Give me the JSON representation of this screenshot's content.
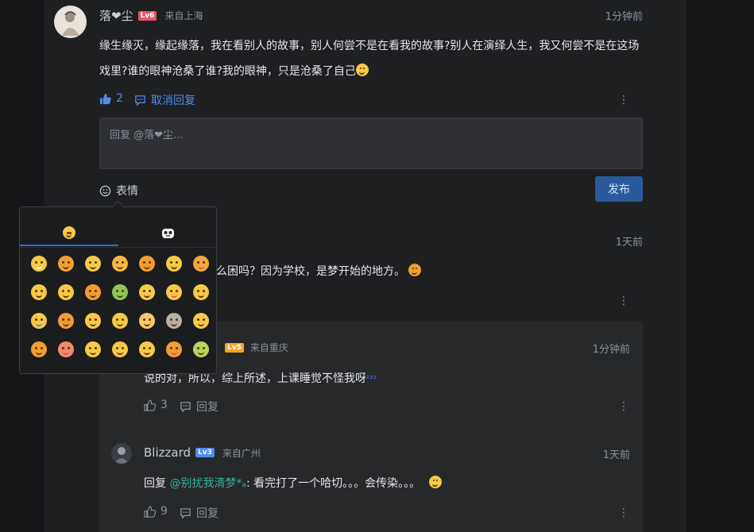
{
  "colors": {
    "blue": "#4e8cf0",
    "lv6": "#e8556a",
    "lv5": "#f5a623",
    "lv3": "#4e8cf0",
    "publish": "#2a5a9b"
  },
  "comment1": {
    "user": "落❤尘",
    "level": "Lv6",
    "location": "来自上海",
    "time": "1分钟前",
    "text_line1": "缘生缘灭，缘起缘落，我在看别人的故事，别人何尝不是在看我的故事?别人在演绎人生，我又何尝不是在这场",
    "text_line2": "戏里?谁的眼神沧桑了谁?我的眼神，只是沧桑了自己",
    "likes": "2",
    "cancel_reply": "取消回复",
    "more": "⋮"
  },
  "reply_box": {
    "placeholder": "回复 @落❤尘...",
    "emoji_label": "表情",
    "publish": "发布"
  },
  "comment2": {
    "time": "1天前",
    "text_visible": "么困吗？因为学校，是梦开始的地方。",
    "more": "⋮"
  },
  "reply1": {
    "level": "Lv5",
    "location": "来自重庆",
    "time": "1分钟前",
    "text": "说的对，所以，综上所述，上课睡觉不怪我呀",
    "zzz": "ᶻᶻᶻ",
    "likes": "3",
    "reply_label": "回复",
    "more": "⋮"
  },
  "reply2": {
    "user": "Blizzard",
    "level": "Lv3",
    "location": "来自广州",
    "time": "1天前",
    "reply_prefix": "回复",
    "mention": "@别扰我清梦*ₐ",
    "text": ": 看完打了一个哈切。。。会传染。。。",
    "likes": "9",
    "reply_label": "回复",
    "more": "⋮"
  },
  "emoji_picker": {
    "tabs": [
      "smiley-faces-tab",
      "panda-faces-tab"
    ]
  }
}
